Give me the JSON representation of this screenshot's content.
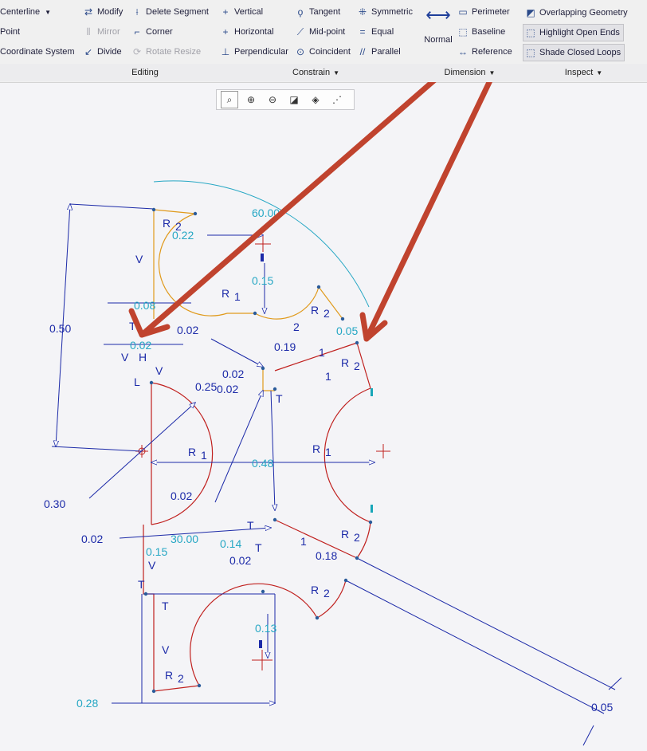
{
  "ribbon": {
    "col1": [
      "Centerline",
      "Point",
      "Coordinate System"
    ],
    "editing": [
      {
        "label": "Modify",
        "icon": "modify-icon",
        "disabled": false
      },
      {
        "label": "Delete Segment",
        "icon": "delete-segment-icon",
        "disabled": false
      },
      {
        "label": "Mirror",
        "icon": "mirror-icon",
        "disabled": true
      },
      {
        "label": "Corner",
        "icon": "corner-icon",
        "disabled": false
      },
      {
        "label": "Divide",
        "icon": "divide-icon",
        "disabled": false
      },
      {
        "label": "Rotate Resize",
        "icon": "rotate-resize-icon",
        "disabled": true
      }
    ],
    "constrain": [
      {
        "label": "Vertical",
        "icon": "vertical-icon"
      },
      {
        "label": "Tangent",
        "icon": "tangent-icon"
      },
      {
        "label": "Symmetric",
        "icon": "symmetric-icon"
      },
      {
        "label": "Horizontal",
        "icon": "horizontal-icon"
      },
      {
        "label": "Mid-point",
        "icon": "midpoint-icon"
      },
      {
        "label": "Equal",
        "icon": "equal-icon"
      },
      {
        "label": "Perpendicular",
        "icon": "perpendicular-icon"
      },
      {
        "label": "Coincident",
        "icon": "coincident-icon"
      },
      {
        "label": "Parallel",
        "icon": "parallel-icon"
      }
    ],
    "dimension": {
      "normal": "Normal",
      "perimeter": "Perimeter",
      "baseline": "Baseline",
      "reference": "Reference"
    },
    "inspect": {
      "overlapping": "Overlapping Geometry",
      "highlight": "Highlight Open Ends",
      "shade": "Shade Closed Loops"
    },
    "groups": {
      "editing": "Editing",
      "constrain": "Constrain",
      "dimension": "Dimension",
      "inspect": "Inspect"
    }
  },
  "view_toolbar": [
    "refit-icon",
    "zoom-in-icon",
    "zoom-out-icon",
    "repaint-icon",
    "display-style-icon",
    "sketcher-display-filter-icon"
  ],
  "sketch": {
    "dims": {
      "d_060": "60.00",
      "d_022": "0.22",
      "d_015a": "0.15",
      "d_008": "0.08",
      "d_002a": "0.02",
      "d_002b": "0.02",
      "d_002c": "0.02",
      "d_002d": "0.02",
      "d_002e": "0.02",
      "d_002f": "0.02",
      "d_002g": "0.02",
      "d_019": "0.19",
      "d_005a": "0.05",
      "d_025": "0.25",
      "d_050": "0.50",
      "d_048": "0.48",
      "d_030": "0.30",
      "d_3000": "30.00",
      "d_014": "0.14",
      "d_015b": "0.15",
      "d_018": "0.18",
      "d_013": "0.13",
      "d_028": "0.28",
      "d_005b": "0.05"
    },
    "labels": {
      "R": "R",
      "one": "1",
      "two": "2",
      "V": "V",
      "H": "H",
      "T": "T",
      "L": "L"
    }
  },
  "colors": {
    "annotation_arrow": "#c0432e",
    "dimension": "#26a7c4",
    "constraint": "#1c2aa8",
    "geometry_red": "#c0201e",
    "geometry_orange": "#e09a1c"
  }
}
